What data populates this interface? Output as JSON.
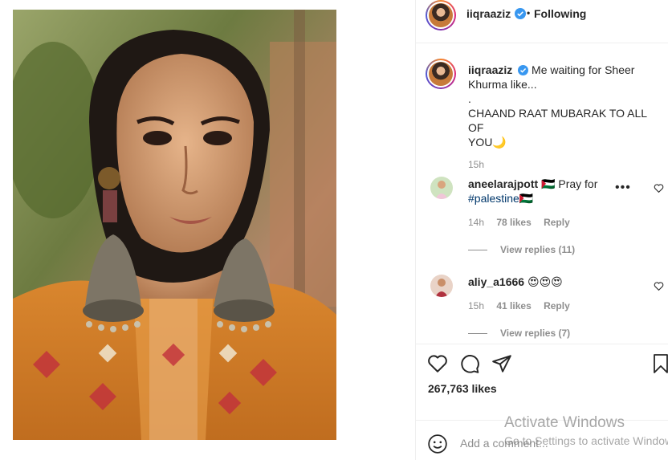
{
  "post": {
    "username": "iiqraaziz",
    "follow_status": "Following",
    "separator": "•",
    "caption_lines": [
      "Me waiting for Sheer",
      "Khurma like...",
      ".",
      "CHAAND RAAT MUBARAK TO ALL OF",
      "YOU🌙"
    ],
    "caption_time": "15h",
    "like_count": "267,763 likes",
    "add_comment_placeholder": "Add a comment..."
  },
  "comments": [
    {
      "username": "aneelarajpott",
      "text_prefix": "🇵🇸 Pray for",
      "hashtag": "#palestine🇵🇸",
      "time": "14h",
      "likes": "78 likes",
      "reply_label": "Reply",
      "view_replies": "View replies (11)"
    },
    {
      "username": "aliy_a1666",
      "text": "😍😍😍",
      "time": "15h",
      "likes": "41 likes",
      "reply_label": "Reply",
      "view_replies": "View replies (7)"
    }
  ],
  "more_options_label": "•••",
  "watermark": {
    "title": "Activate Windows",
    "subtitle": "Go to Settings to activate Windows."
  },
  "icons": {
    "like": "heart-outline-icon",
    "comment": "comment-bubble-icon",
    "share": "paper-plane-icon",
    "save": "bookmark-icon",
    "emoji": "smiley-icon",
    "verified": "verified-badge-icon"
  },
  "colors": {
    "verified_blue": "#3897f0",
    "hashtag": "#00376b",
    "secondary_text": "#8e8e8e"
  }
}
